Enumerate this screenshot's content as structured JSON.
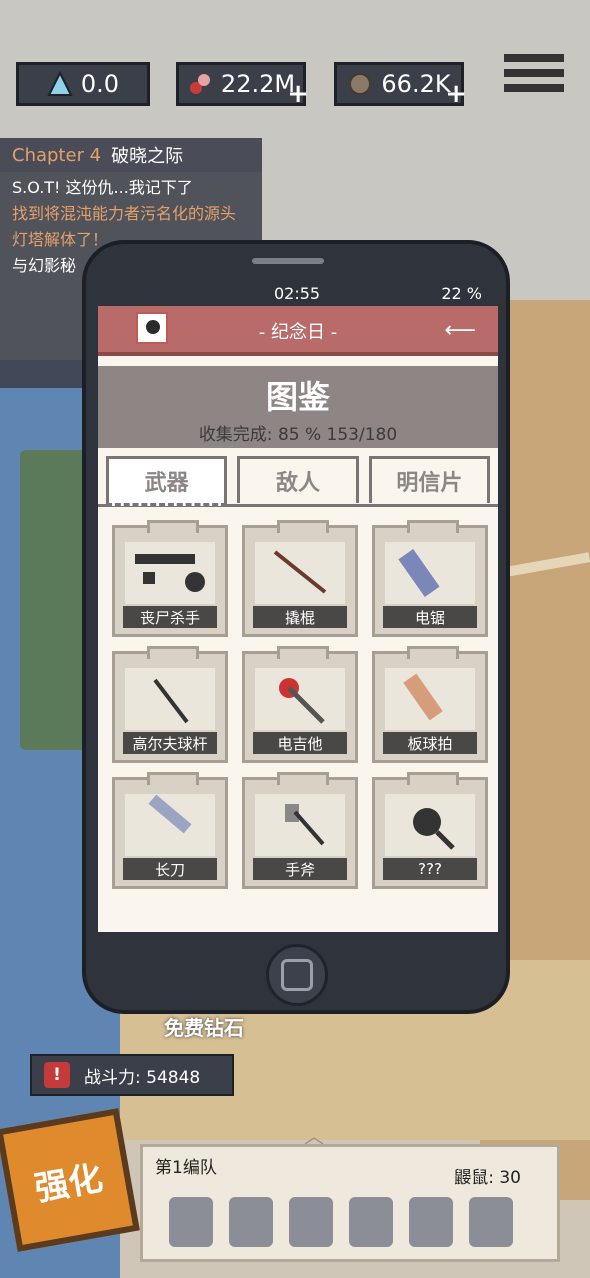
{
  "resources": {
    "crystal": "0.0",
    "meat": "22.2M",
    "coin": "66.2K"
  },
  "quest_panel": {
    "chapter_num": "Chapter 4",
    "chapter_title": "破晓之际",
    "items": [
      "S.O.T!  这份仇...我记下了",
      "找到将混沌能力者污名化的源头",
      "灯塔解体了！",
      "与幻影秘"
    ]
  },
  "phone": {
    "time": "02:55",
    "battery": "22 %",
    "app_title": "- 纪念日 -",
    "page_title": "图鉴",
    "progress": "收集完成: 85 %  153/180",
    "tabs": [
      "武器",
      "敌人",
      "明信片"
    ],
    "weapons": [
      "丧尸杀手",
      "撬棍",
      "电锯",
      "高尔夫球杆",
      "电吉他",
      "板球拍",
      "长刀",
      "手斧",
      "???"
    ]
  },
  "bottom": {
    "free_diamond": "免费钻石",
    "power_label": "战斗力: 54848",
    "squad_name": "第1编队",
    "rats": "鼹鼠: 30",
    "upgrade": "强化"
  }
}
